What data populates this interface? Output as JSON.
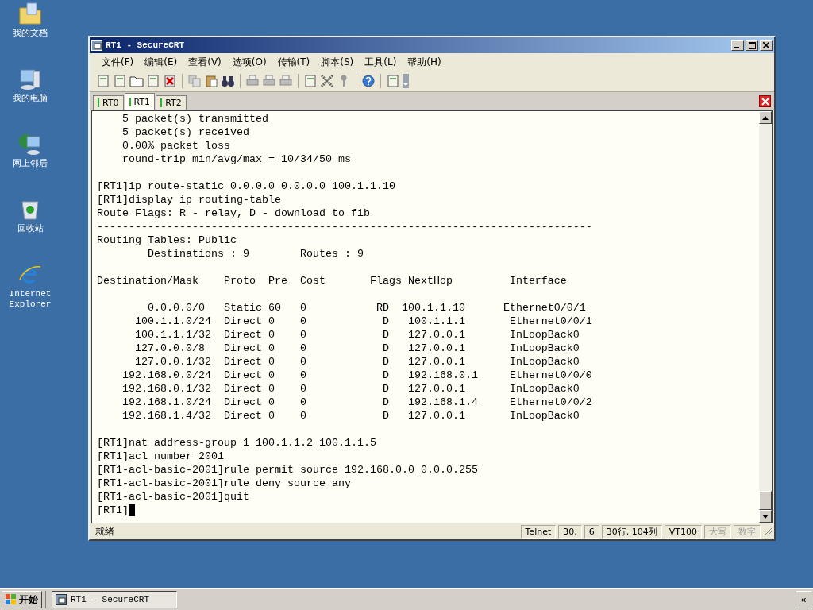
{
  "desktop_icons": [
    {
      "label": "我的文档",
      "kind": "folder"
    },
    {
      "label": "我的电脑",
      "kind": "computer"
    },
    {
      "label": "网上邻居",
      "kind": "network"
    },
    {
      "label": "回收站",
      "kind": "recycle"
    },
    {
      "label": "Internet Explorer",
      "kind": "browser"
    }
  ],
  "window": {
    "title": "RT1 - SecureCRT"
  },
  "menu": [
    "文件(F)",
    "编辑(E)",
    "查看(V)",
    "选项(O)",
    "传输(T)",
    "脚本(S)",
    "工具(L)",
    "帮助(H)"
  ],
  "tabs": [
    {
      "label": "RT0",
      "selected": false
    },
    {
      "label": "RT1",
      "selected": true
    },
    {
      "label": "RT2",
      "selected": false
    }
  ],
  "terminal": {
    "blocks": [
      [
        "    5 packet(s) transmitted",
        "    5 packet(s) received",
        "    0.00% packet loss",
        "    round-trip min/avg/max = 10/34/50 ms"
      ],
      [
        "[RT1]ip route-static 0.0.0.0 0.0.0.0 100.1.1.10",
        "[RT1]display ip routing-table",
        "Route Flags: R - relay, D - download to fib",
        "------------------------------------------------------------------------------",
        "Routing Tables: Public",
        "        Destinations : 9        Routes : 9"
      ],
      [
        "Destination/Mask    Proto  Pre  Cost       Flags NextHop         Interface"
      ],
      [
        "        0.0.0.0/0   Static 60   0           RD  100.1.1.10      Ethernet0/0/1",
        "      100.1.1.0/24  Direct 0    0            D   100.1.1.1       Ethernet0/0/1",
        "      100.1.1.1/32  Direct 0    0            D   127.0.0.1       InLoopBack0",
        "      127.0.0.0/8   Direct 0    0            D   127.0.0.1       InLoopBack0",
        "      127.0.0.1/32  Direct 0    0            D   127.0.0.1       InLoopBack0",
        "    192.168.0.0/24  Direct 0    0            D   192.168.0.1     Ethernet0/0/0",
        "    192.168.0.1/32  Direct 0    0            D   127.0.0.1       InLoopBack0",
        "    192.168.1.0/24  Direct 0    0            D   192.168.1.4     Ethernet0/0/2",
        "    192.168.1.4/32  Direct 0    0            D   127.0.0.1       InLoopBack0"
      ],
      [
        "[RT1]nat address-group 1 100.1.1.2 100.1.1.5",
        "[RT1]acl number 2001",
        "[RT1-acl-basic-2001]rule permit source 192.168.0.0 0.0.0.255",
        "[RT1-acl-basic-2001]rule deny source any",
        "[RT1-acl-basic-2001]quit"
      ]
    ],
    "prompt": "[RT1]",
    "cursor": true
  },
  "status_bar": [
    {
      "text": "就绪",
      "disabled": false
    },
    {
      "text": "Telnet",
      "disabled": false
    },
    {
      "text": "30,",
      "disabled": false
    },
    {
      "text": "6",
      "disabled": false
    },
    {
      "text": "30行, 104列",
      "disabled": false
    },
    {
      "text": "VT100",
      "disabled": false
    },
    {
      "text": "大写",
      "disabled": true
    },
    {
      "text": "数字",
      "disabled": true
    }
  ],
  "taskbar": {
    "start": "开始",
    "tasks": [
      {
        "label": "RT1 - SecureCRT",
        "selected": true
      }
    ],
    "tray": "«"
  }
}
